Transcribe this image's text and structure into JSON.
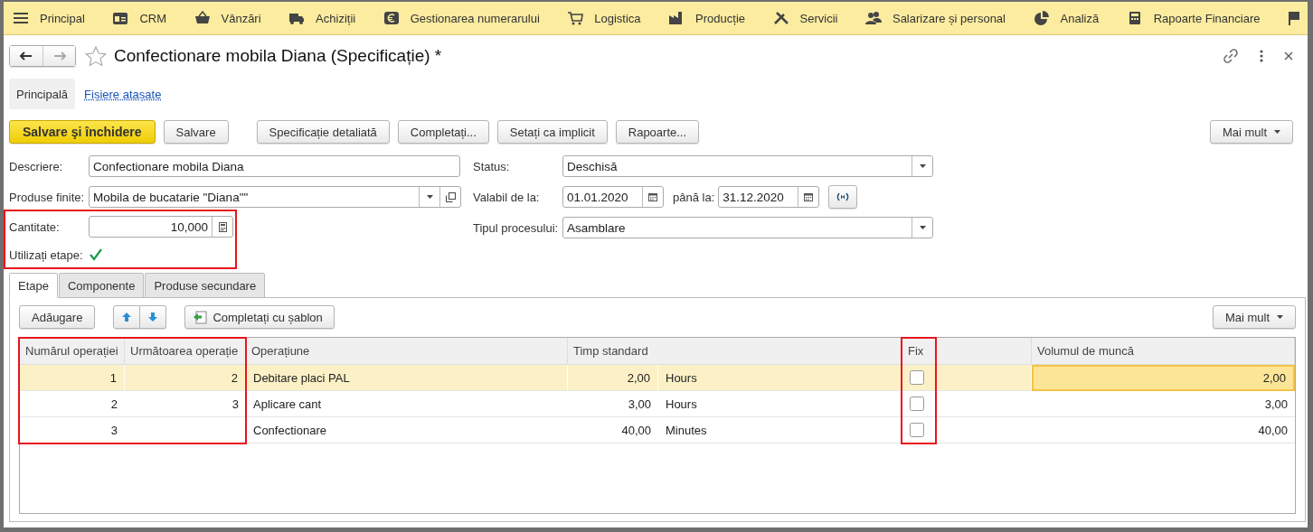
{
  "menu": [
    {
      "label": "Principal"
    },
    {
      "label": "CRM"
    },
    {
      "label": "Vânzări"
    },
    {
      "label": "Achiziții"
    },
    {
      "label": "Gestionarea numerarului"
    },
    {
      "label": "Logistica"
    },
    {
      "label": "Producție"
    },
    {
      "label": "Servicii"
    },
    {
      "label": "Salarizare și personal"
    },
    {
      "label": "Analiză"
    },
    {
      "label": "Rapoarte Financiare"
    }
  ],
  "window": {
    "title": "Confectionare mobila Diana (Specificație) *",
    "favorite": false,
    "back_disabled": false,
    "forward_disabled": true
  },
  "form_tabs": [
    {
      "label": "Principală",
      "selected": true
    },
    {
      "label": "Fișiere atașate",
      "selected": false
    }
  ],
  "toolbar": {
    "buttons": [
      {
        "label": "Salvare şi închidere",
        "kind": "primary"
      },
      {
        "label": "Salvare",
        "kind": "default"
      },
      {
        "label": "Specificație detaliată",
        "kind": "gap"
      },
      {
        "label": "Completați...",
        "kind": "default"
      },
      {
        "label": "Setați ca implicit",
        "kind": "default"
      },
      {
        "label": "Rapoarte...",
        "kind": "default"
      }
    ],
    "more": "Mai mult"
  },
  "fields": {
    "description": {
      "label": "Descriere:",
      "value": "Confectionare mobila Diana"
    },
    "finished_products": {
      "label": "Produse finite:",
      "value": "Mobila de bucatarie \"Diana\"\""
    },
    "quantity": {
      "label": "Cantitate:",
      "value": "10,000"
    },
    "use_stages": {
      "label": "Utilizați etape:",
      "checked": true
    },
    "highlighted": true,
    "status": {
      "label": "Status:",
      "value": "Deschisă"
    },
    "valid_from": {
      "label": "Valabil de la:",
      "value": "01.01.2020"
    },
    "valid_to": {
      "label": "până la:",
      "value": "31.12.2020"
    },
    "process_type": {
      "label": "Tipul procesului:",
      "value": "Asamblare"
    }
  },
  "tabs": [
    {
      "label": "Etape",
      "selected": true
    },
    {
      "label": "Componente",
      "selected": false
    },
    {
      "label": "Produse secundare",
      "selected": false
    }
  ],
  "table_toolbar": {
    "add": "Adăugare",
    "fill": "Completați cu șablon",
    "more": "Mai mult"
  },
  "table": {
    "columns": [
      {
        "label": "Numărul operației",
        "highlighted": true
      },
      {
        "label": "Următoarea operație",
        "highlighted": true
      },
      {
        "label": "Operațiune",
        "highlighted": false
      },
      {
        "label": "Timp standard",
        "highlighted": false
      },
      {
        "label": "Fix",
        "highlighted": true
      },
      {
        "label": "Volumul de muncă",
        "highlighted": false
      }
    ],
    "rows": [
      {
        "number": "1",
        "next": "2",
        "operation": "Debitare placi PAL",
        "time": "2,00",
        "unit": "Hours",
        "fix": false,
        "volume": "2,00",
        "selected": true,
        "volume_focused": true
      },
      {
        "number": "2",
        "next": "3",
        "operation": "Aplicare cant",
        "time": "3,00",
        "unit": "Hours",
        "fix": false,
        "volume": "3,00",
        "selected": false,
        "volume_focused": false
      },
      {
        "number": "3",
        "operation": "Confectionare",
        "time": "40,00",
        "unit": "Minutes",
        "fix": false,
        "volume": "40,00",
        "selected": false,
        "volume_focused": false
      }
    ]
  }
}
